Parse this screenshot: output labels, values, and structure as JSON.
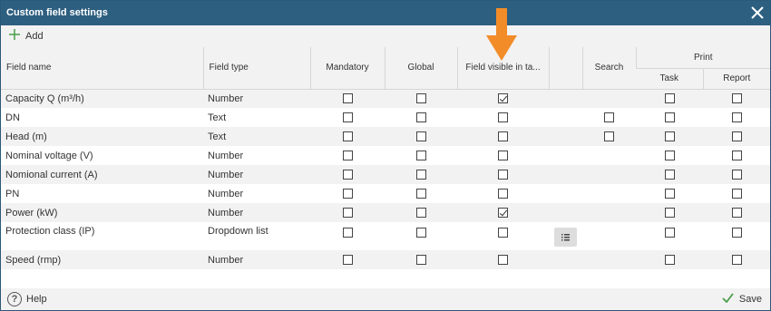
{
  "dialog": {
    "title": "Custom field settings",
    "close_icon": "close-icon",
    "accent_color": "#2d5f80",
    "highlight_arrow_color": "#f28c28"
  },
  "toolbar": {
    "add_label": "Add",
    "add_icon": "plus-icon"
  },
  "columns": {
    "field_name": "Field name",
    "field_type": "Field type",
    "mandatory": "Mandatory",
    "global": "Global",
    "field_visible": "Field visible in ta...",
    "search": "Search",
    "print": "Print",
    "task": "Task",
    "report": "Report"
  },
  "rows": [
    {
      "name": "Capacity Q (m³/h)",
      "type": "Number",
      "mandatory": false,
      "global": false,
      "visible": true,
      "list": false,
      "search": null,
      "task": false,
      "report": false
    },
    {
      "name": "DN",
      "type": "Text",
      "mandatory": false,
      "global": false,
      "visible": false,
      "list": false,
      "search": false,
      "task": false,
      "report": false
    },
    {
      "name": "Head (m)",
      "type": "Text",
      "mandatory": false,
      "global": false,
      "visible": false,
      "list": false,
      "search": false,
      "task": false,
      "report": false
    },
    {
      "name": "Nominal voltage (V)",
      "type": "Number",
      "mandatory": false,
      "global": false,
      "visible": false,
      "list": false,
      "search": null,
      "task": false,
      "report": false
    },
    {
      "name": "Nomional current (A)",
      "type": "Number",
      "mandatory": false,
      "global": false,
      "visible": false,
      "list": false,
      "search": null,
      "task": false,
      "report": false
    },
    {
      "name": "PN",
      "type": "Number",
      "mandatory": false,
      "global": false,
      "visible": false,
      "list": false,
      "search": null,
      "task": false,
      "report": false
    },
    {
      "name": "Power (kW)",
      "type": "Number",
      "mandatory": false,
      "global": false,
      "visible": true,
      "list": false,
      "search": null,
      "task": false,
      "report": false
    },
    {
      "name": "Protection class (IP)",
      "type": "Dropdown list",
      "mandatory": false,
      "global": false,
      "visible": false,
      "list": true,
      "search": null,
      "task": false,
      "report": false
    },
    {
      "name": "Speed (rmp)",
      "type": "Number",
      "mandatory": false,
      "global": false,
      "visible": false,
      "list": false,
      "search": null,
      "task": false,
      "report": false
    }
  ],
  "footer": {
    "help_label": "Help",
    "help_icon": "help-icon",
    "save_label": "Save",
    "save_icon": "checkmark-icon",
    "save_icon_color": "#4a9d4a"
  }
}
